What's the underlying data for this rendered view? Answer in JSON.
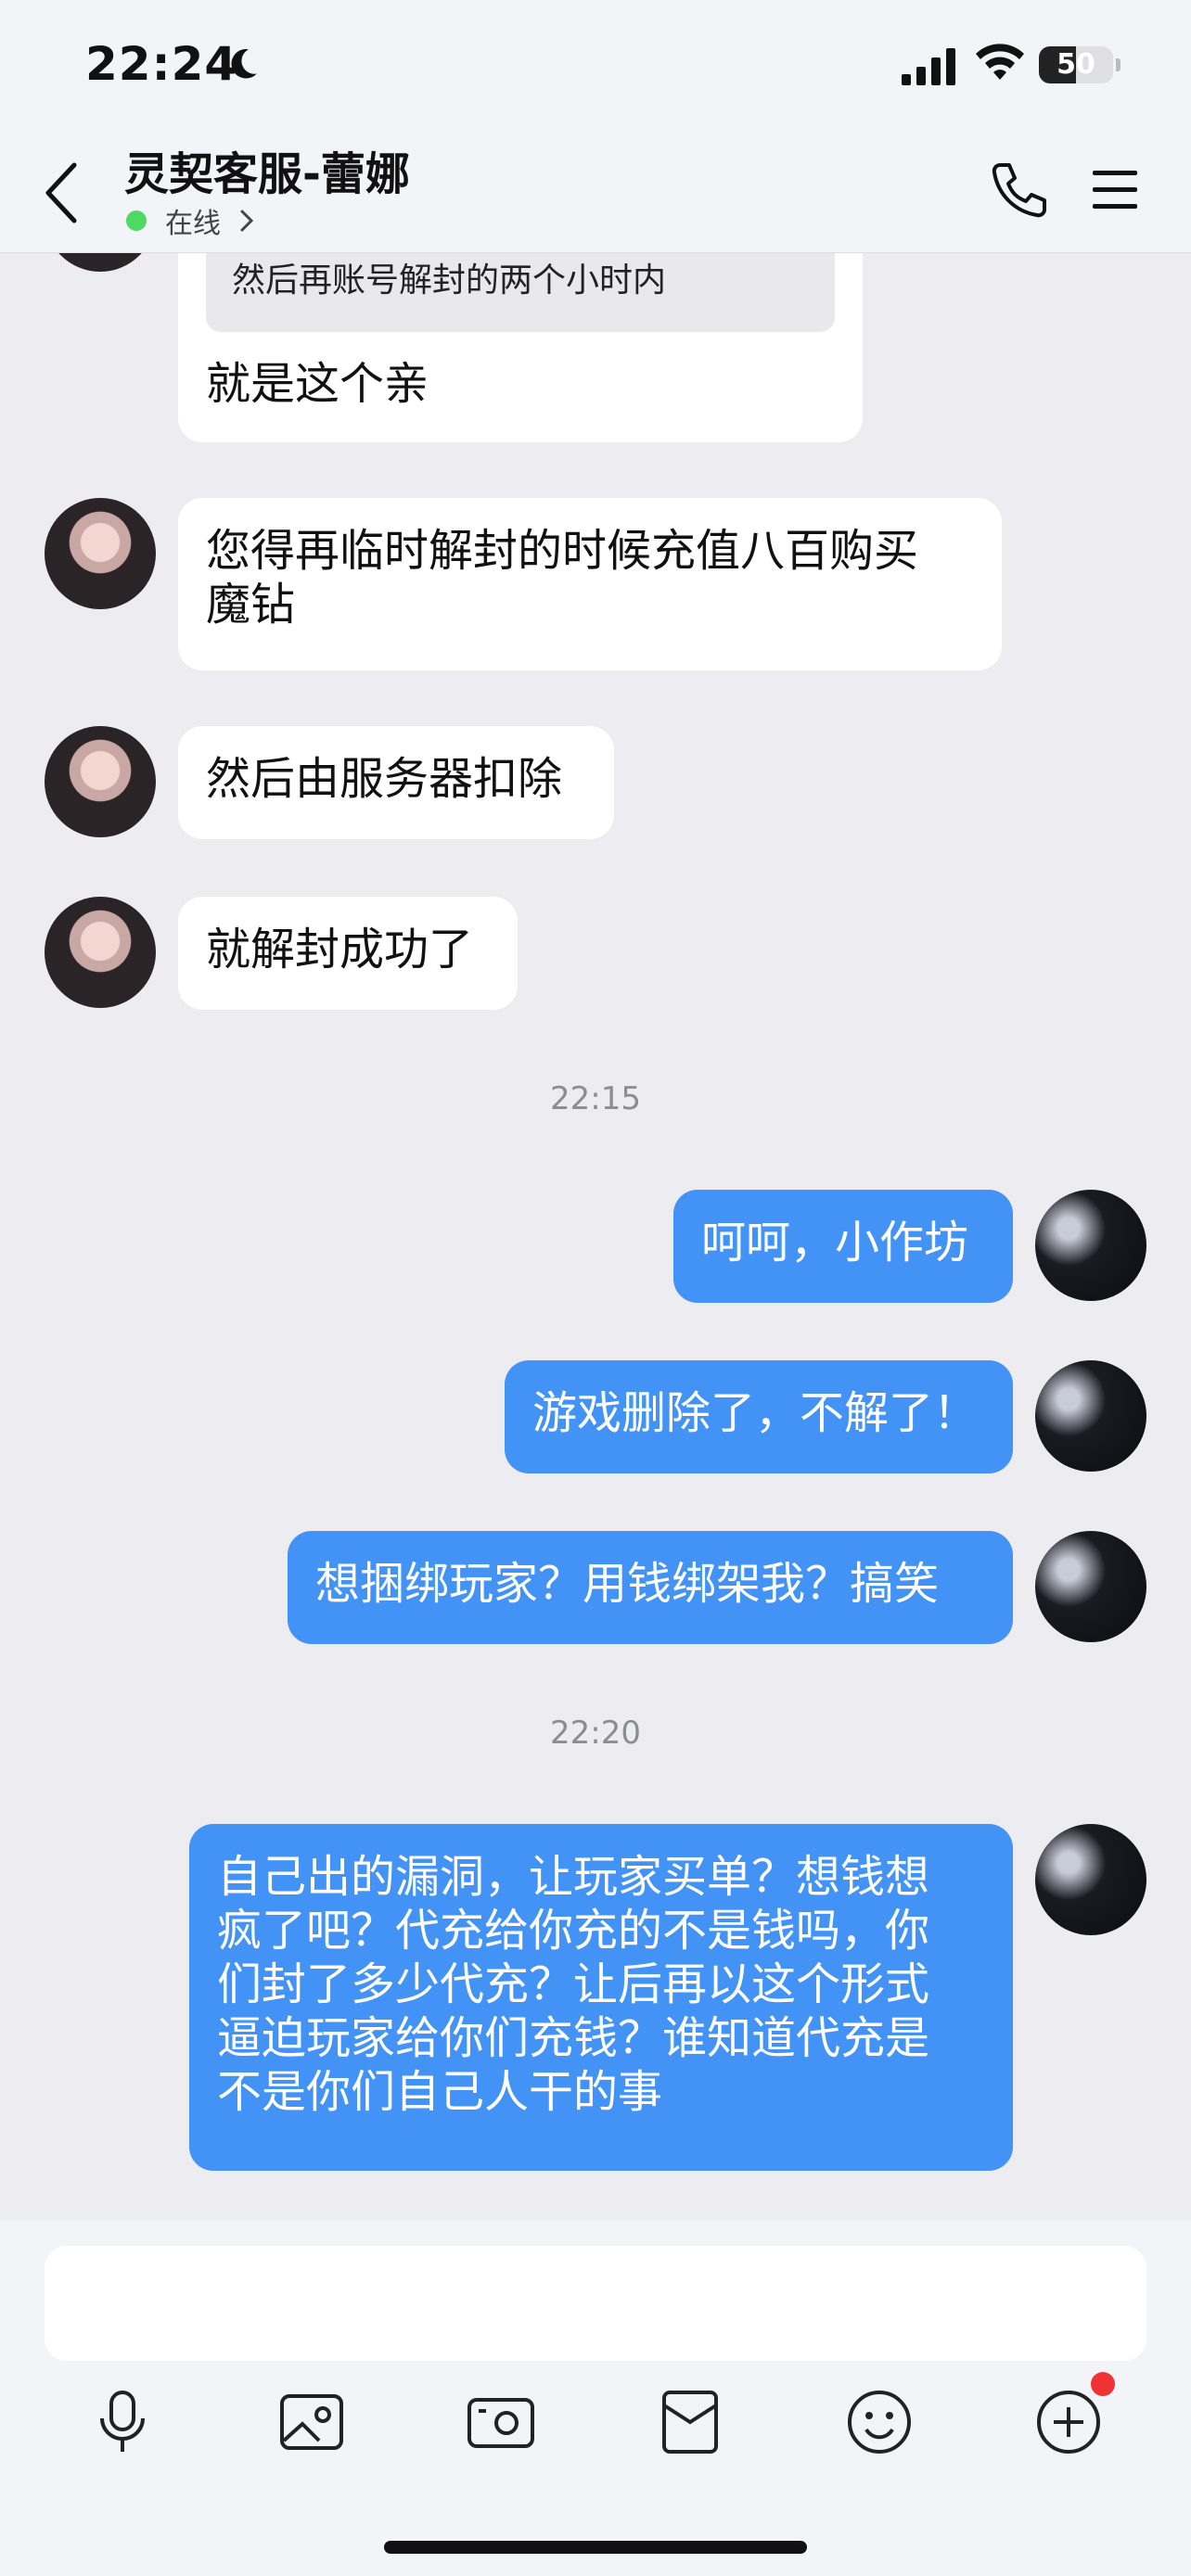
{
  "status_bar": {
    "time": "22:24",
    "battery": "50",
    "battery_level": 0.5
  },
  "header": {
    "title": "灵契客服-蕾娜",
    "status": "在线"
  },
  "messages": {
    "quoted_text": "然后再账号解封的两个小时内",
    "m1": "就是这个亲",
    "m2_line1": "您得再临时解封的时候充值八百购买",
    "m2_line2": "魔钻",
    "m3": "然后由服务器扣除",
    "m4": "就解封成功了",
    "ts1": "22:15",
    "m5": "呵呵，小作坊",
    "m6": "游戏删除了，不解了！",
    "m7": "想捆绑玩家？用钱绑架我？搞笑",
    "ts2": "22:20",
    "m8_line1": "自己出的漏洞，让玩家买单？想钱想",
    "m8_line2": "疯了吧？代充给你充的不是钱吗，你",
    "m8_line3": "们封了多少代充？让后再以这个形式",
    "m8_line4": "逼迫玩家给你们充钱？谁知道代充是",
    "m8_line5": "不是你们自己人干的事"
  },
  "toolbar": {
    "icons": [
      "microphone-icon",
      "image-icon",
      "camera-icon",
      "red-packet-icon",
      "emoji-icon",
      "plus-icon"
    ],
    "has_badge": true
  },
  "colors": {
    "accent": "#4293f5",
    "online": "#4cd964",
    "badge": "#f03232"
  }
}
